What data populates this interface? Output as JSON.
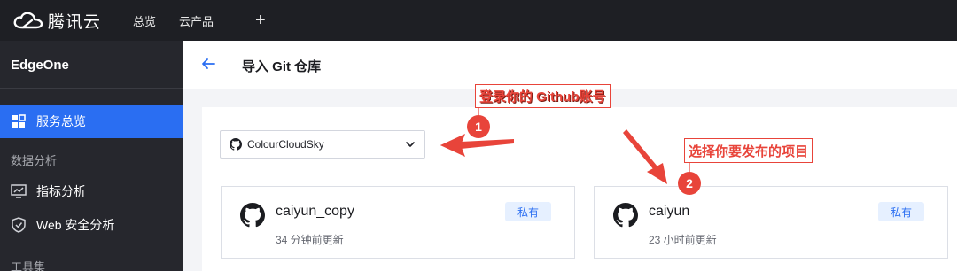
{
  "topbar": {
    "brand": "腾讯云",
    "nav": [
      "总览",
      "云产品"
    ],
    "plus": "+"
  },
  "sidebar": {
    "title": "EdgeOne",
    "active_item": "服务总览",
    "sections": [
      {
        "label": "数据分析",
        "items": [
          "指标分析",
          "Web 安全分析"
        ]
      },
      {
        "label": "工具集"
      }
    ]
  },
  "header": {
    "title": "导入 Git 仓库"
  },
  "account_select": {
    "value": "ColourCloudSky"
  },
  "repos": [
    {
      "name": "caiyun_copy",
      "updated": "34 分钟前更新",
      "badge": "私有"
    },
    {
      "name": "caiyun",
      "updated": "23 小时前更新",
      "badge": "私有"
    }
  ],
  "annotations": [
    {
      "number": "1",
      "text": "登录你的 Github账号"
    },
    {
      "number": "2",
      "text": "选择你要发布的项目"
    }
  ],
  "colors": {
    "accent": "#2a6ef2",
    "annotation": "#e8443a",
    "sidebar_bg": "#26272d",
    "topbar_bg": "#1e1f24"
  }
}
